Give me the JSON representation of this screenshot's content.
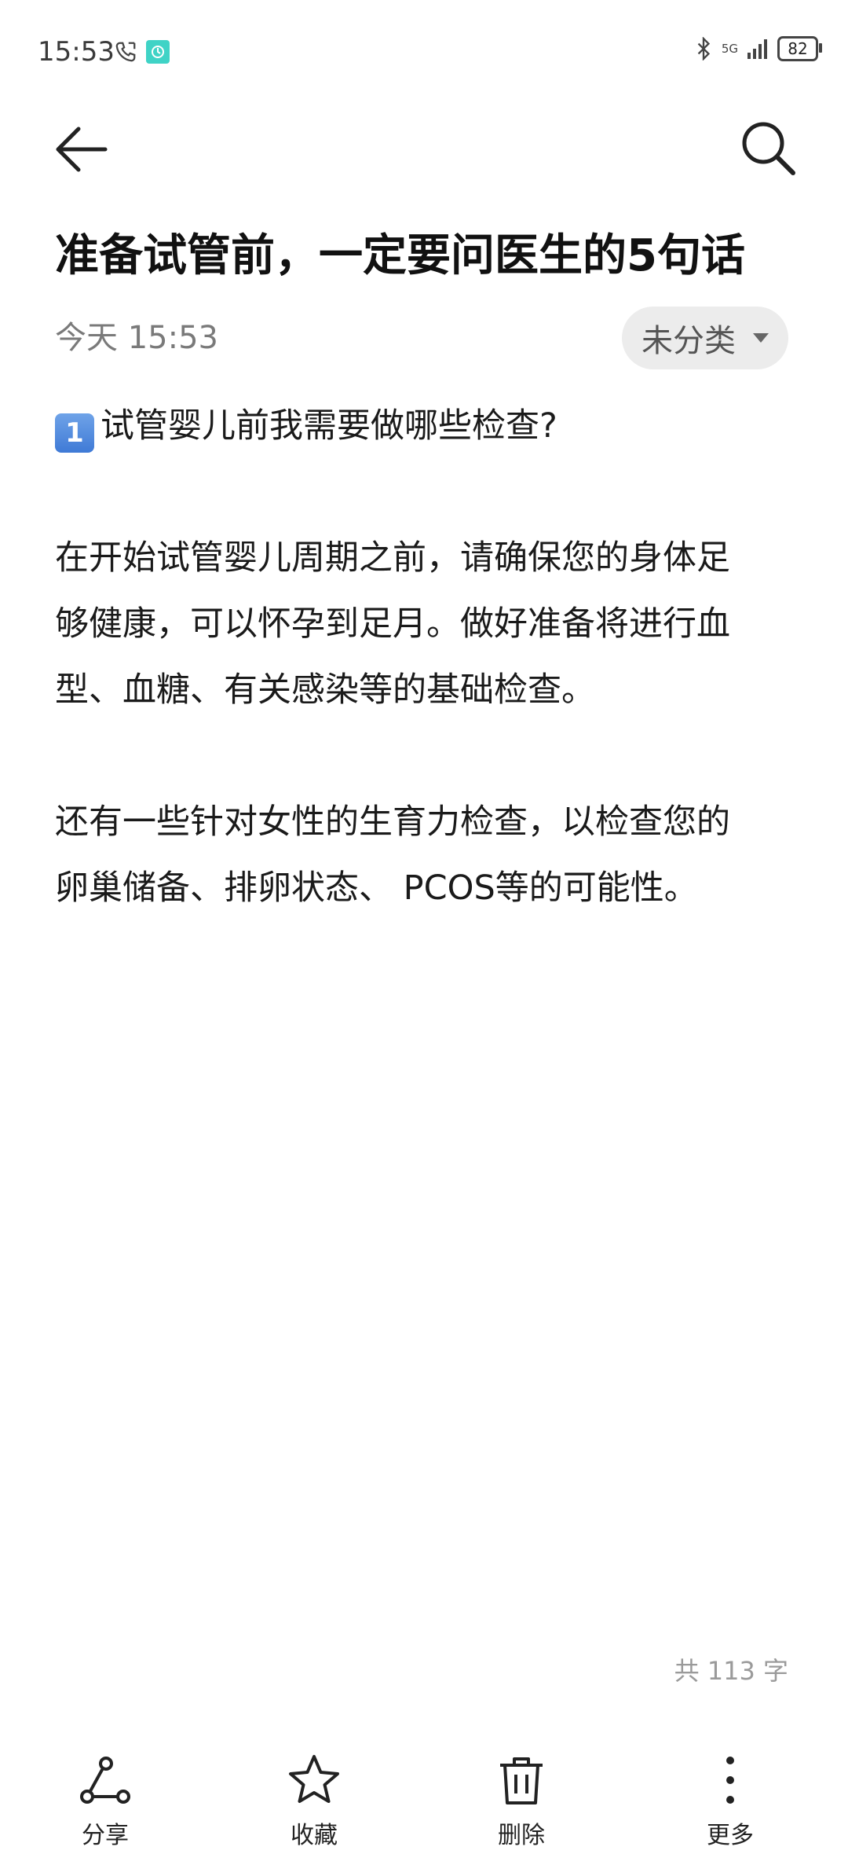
{
  "status_bar": {
    "time": "15:53",
    "network": "5G",
    "battery": "82"
  },
  "note": {
    "title": "准备试管前，一定要问医生的5句话",
    "date": "今天 15:53",
    "category": "未分类",
    "keycap_number": "1",
    "lines": [
      "试管婴儿前我需要做哪些检查?",
      "在开始试管婴儿周期之前，请确保您的身体足",
      "够健康，可以怀孕到足月。做好准备将进行血",
      "型、血糖、有关感染等的基础检查。",
      "还有一些针对女性的生育力检查，以检查您的",
      "卵巢储备、排卵状态、 PCOS等的可能性。"
    ],
    "word_count": "共 113 字"
  },
  "toolbar": {
    "share": "分享",
    "favorite": "收藏",
    "delete": "删除",
    "more": "更多"
  },
  "colors": {
    "chip_bg": "#ececec",
    "keycap": "#3f7ad6"
  }
}
